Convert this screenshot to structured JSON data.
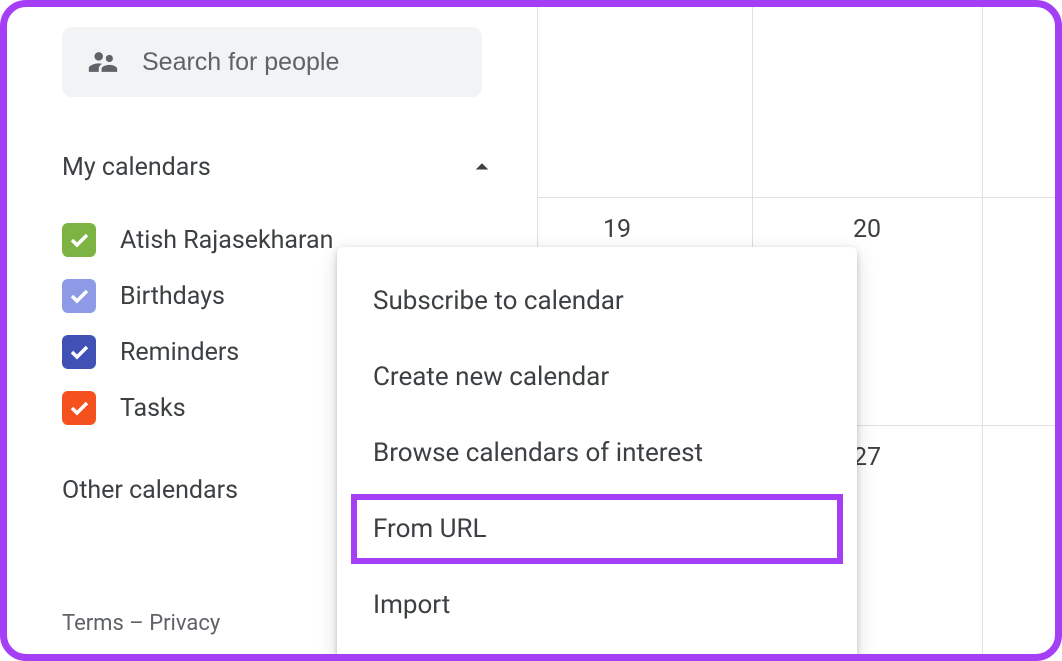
{
  "search": {
    "placeholder": "Search for people"
  },
  "sections": {
    "my_calendars_title": "My calendars",
    "other_calendars_title": "Other calendars"
  },
  "calendars": [
    {
      "label": "Atish Rajasekharan",
      "color": "#7cb342"
    },
    {
      "label": "Birthdays",
      "color": "#8e9ae6"
    },
    {
      "label": "Reminders",
      "color": "#3f51b5"
    },
    {
      "label": "Tasks",
      "color": "#f4511e"
    }
  ],
  "footer": {
    "terms": "Terms",
    "sep": " – ",
    "privacy": "Privacy"
  },
  "grid_dates": {
    "d19": "19",
    "d20": "20",
    "d27": "27"
  },
  "menu": {
    "subscribe": "Subscribe to calendar",
    "create": "Create new calendar",
    "browse": "Browse calendars of interest",
    "from_url": "From URL",
    "import": "Import"
  }
}
